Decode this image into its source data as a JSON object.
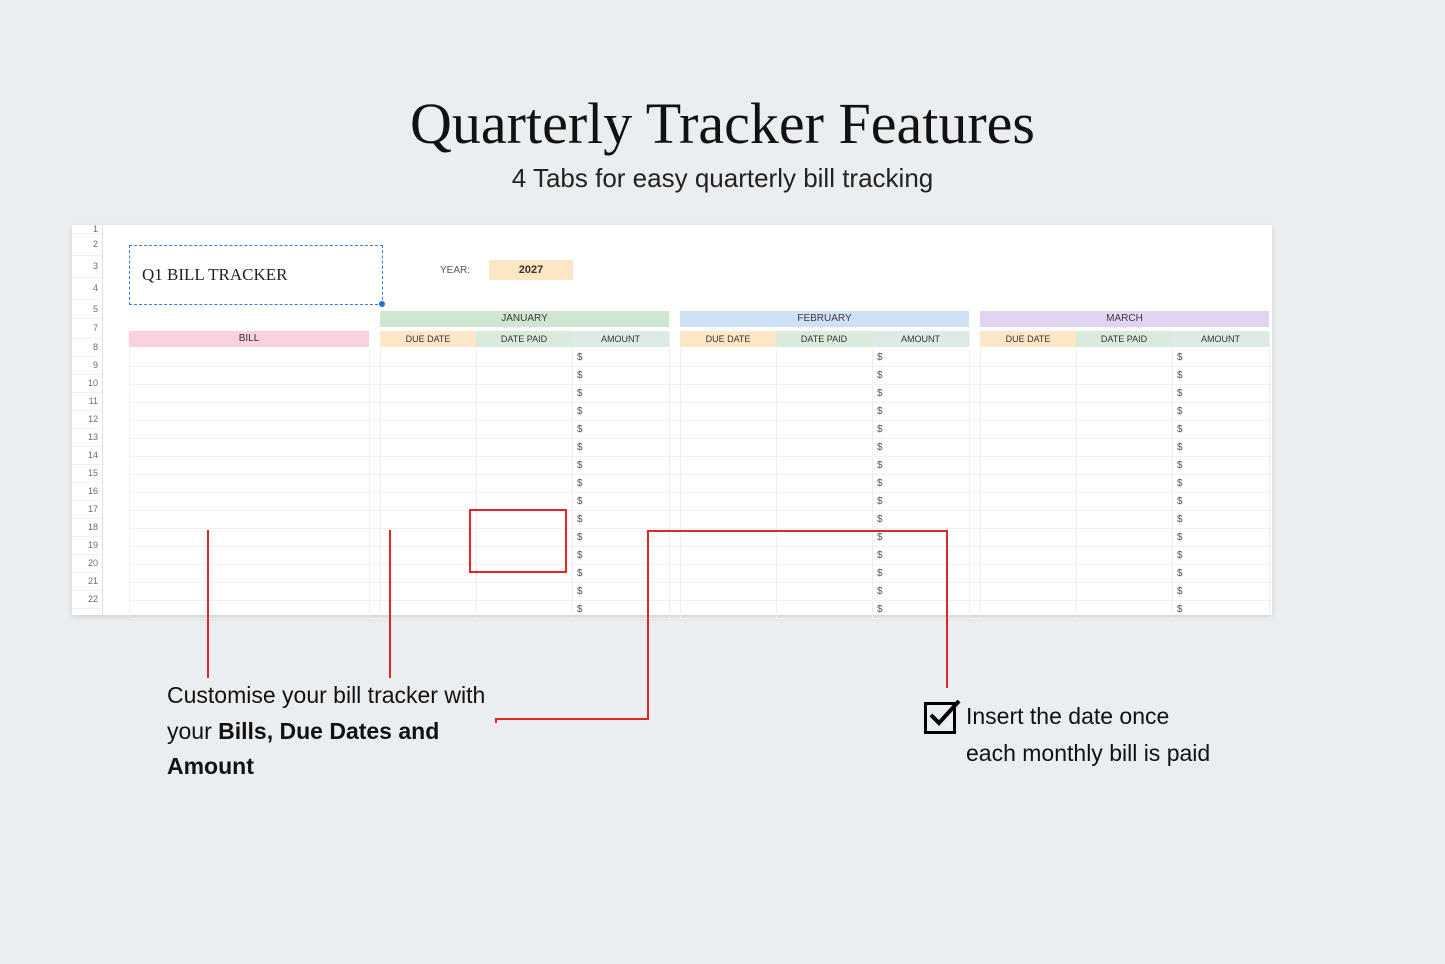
{
  "heading": {
    "title": "Quarterly Tracker Features",
    "subtitle": "4 Tabs for easy quarterly bill tracking"
  },
  "sheet": {
    "selected_cell_text": "Q1 BILL TRACKER",
    "year_label": "YEAR:",
    "year_value": "2027",
    "row_numbers": [
      "1",
      "2",
      "3",
      "4",
      "5",
      "7",
      "8",
      "9",
      "10",
      "11",
      "12",
      "13",
      "14",
      "15",
      "16",
      "17",
      "18",
      "19",
      "20",
      "21",
      "22"
    ],
    "bill_header": "BILL",
    "months": {
      "jan": "JANUARY",
      "feb": "FEBRUARY",
      "mar": "MARCH"
    },
    "columns": {
      "due": "DUE DATE",
      "paid": "DATE PAID",
      "amount": "AMOUNT"
    },
    "amount_placeholder": "$",
    "body_row_count": 15
  },
  "callouts": {
    "left_pre": "Customise your bill tracker with your ",
    "left_bold": "Bills, Due Dates and Amount",
    "right": "Insert the date once each monthly bill is paid"
  }
}
